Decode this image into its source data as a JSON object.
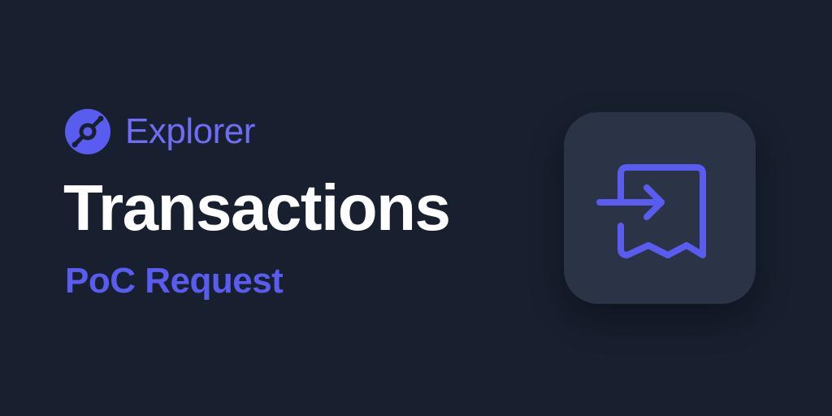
{
  "brand": {
    "logo_icon": "helium-logo-icon",
    "name": "Explorer"
  },
  "header": {
    "title": "Transactions",
    "subtitle": "PoC Request"
  },
  "hero_icon": {
    "name": "receipt-arrow-in-icon"
  },
  "colors": {
    "background": "#181f2e",
    "accent": "#5a5cf0",
    "accent_light": "#6f6cf5",
    "title": "#ffffff",
    "tile": "#2b3447"
  }
}
